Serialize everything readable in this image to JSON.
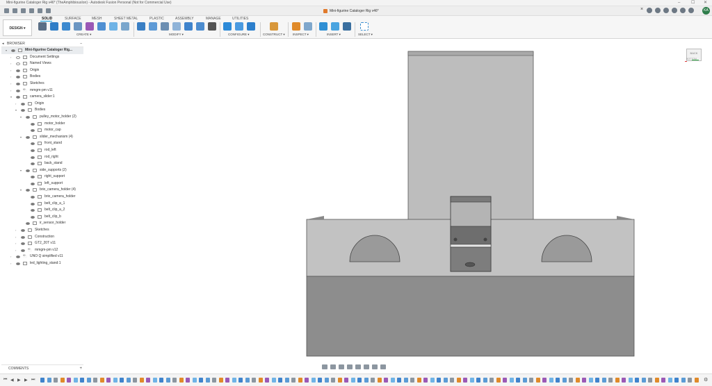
{
  "window": {
    "title": "Mini-figurine Cataloger Rig v46* (TheAmphibiousIon) - Autodesk Fusion Personal (Not for Commercial Use)",
    "minimize": "–",
    "maximize": "☐",
    "close": "✕"
  },
  "document_tab": {
    "label": "Mini-figurine Cataloger Rig v46*",
    "close": "×"
  },
  "user": {
    "initials": "KA"
  },
  "workspace": {
    "label": "DESIGN ▾"
  },
  "ribbon": {
    "tabs": [
      "SOLID",
      "SURFACE",
      "MESH",
      "SHEET METAL",
      "PLASTIC",
      "ASSEMBLY",
      "MANAGE",
      "UTILITIES"
    ],
    "active_tab": "SOLID",
    "groups": [
      "CREATE ▾",
      "MODIFY ▾",
      "CONFIGURE ▾",
      "CONSTRUCT ▾",
      "INSPECT ▾",
      "INSERT ▾",
      "SELECT ▾"
    ]
  },
  "browser": {
    "header": "BROWSER",
    "rows": [
      {
        "label": "Mini-figurine Cataloger Rig...",
        "depth": 0,
        "arrow": "▾",
        "icon": "component",
        "eye": true,
        "root": true
      },
      {
        "label": "Document Settings",
        "depth": 1,
        "arrow": "›",
        "icon": "gear",
        "eye": false
      },
      {
        "label": "Named Views",
        "depth": 1,
        "arrow": "›",
        "icon": "folder",
        "eye": false
      },
      {
        "label": "Origin",
        "depth": 1,
        "arrow": "›",
        "icon": "folder",
        "eye": true
      },
      {
        "label": "Bodies",
        "depth": 1,
        "arrow": "›",
        "icon": "folder",
        "eye": true
      },
      {
        "label": "Sketches",
        "depth": 1,
        "arrow": "›",
        "icon": "folder",
        "eye": true
      },
      {
        "label": "mmgm-pm v11",
        "depth": 1,
        "arrow": "›",
        "icon": "link",
        "eye": true
      },
      {
        "label": "camera_slider:1",
        "depth": 1,
        "arrow": "▾",
        "icon": "component",
        "eye": true
      },
      {
        "label": "Origin",
        "depth": 2,
        "arrow": "›",
        "icon": "folder",
        "eye": true
      },
      {
        "label": "Bodies",
        "depth": 2,
        "arrow": "▾",
        "icon": "folder",
        "eye": true
      },
      {
        "label": "pulley_motor_holder (2)",
        "depth": 3,
        "arrow": "▾",
        "icon": "folder",
        "eye": true
      },
      {
        "label": "motor_holder",
        "depth": 4,
        "arrow": "",
        "icon": "body",
        "eye": true
      },
      {
        "label": "motor_cap",
        "depth": 4,
        "arrow": "",
        "icon": "body",
        "eye": true
      },
      {
        "label": "slider_mechanism (4)",
        "depth": 3,
        "arrow": "▾",
        "icon": "folder",
        "eye": true
      },
      {
        "label": "front_stand",
        "depth": 4,
        "arrow": "",
        "icon": "body",
        "eye": true
      },
      {
        "label": "rod_left",
        "depth": 4,
        "arrow": "",
        "icon": "body",
        "eye": true
      },
      {
        "label": "rod_right",
        "depth": 4,
        "arrow": "",
        "icon": "body",
        "eye": true
      },
      {
        "label": "back_stand",
        "depth": 4,
        "arrow": "",
        "icon": "body",
        "eye": true
      },
      {
        "label": "side_supports (2)",
        "depth": 3,
        "arrow": "▾",
        "icon": "folder",
        "eye": true
      },
      {
        "label": "right_support",
        "depth": 4,
        "arrow": "",
        "icon": "body",
        "eye": true
      },
      {
        "label": "left_support",
        "depth": 4,
        "arrow": "",
        "icon": "body",
        "eye": true
      },
      {
        "label": "brio_camera_holder (4)",
        "depth": 3,
        "arrow": "▾",
        "icon": "folder",
        "eye": true
      },
      {
        "label": "brio_camera_holder",
        "depth": 4,
        "arrow": "",
        "icon": "body",
        "eye": true
      },
      {
        "label": "belt_clip_a_1",
        "depth": 4,
        "arrow": "",
        "icon": "body",
        "eye": true
      },
      {
        "label": "belt_clip_a_2",
        "depth": 4,
        "arrow": "",
        "icon": "body",
        "eye": true
      },
      {
        "label": "belt_clip_b",
        "depth": 4,
        "arrow": "",
        "icon": "body",
        "eye": true
      },
      {
        "label": "ir_sensor_holder",
        "depth": 3,
        "arrow": "",
        "icon": "body",
        "eye": true
      },
      {
        "label": "Sketches",
        "depth": 2,
        "arrow": "›",
        "icon": "folder",
        "eye": true
      },
      {
        "label": "Construction",
        "depth": 2,
        "arrow": "›",
        "icon": "folder",
        "eye": true
      },
      {
        "label": "GT2_20T v11",
        "depth": 2,
        "arrow": "›",
        "icon": "component",
        "eye": true
      },
      {
        "label": "mmgm-pm v12",
        "depth": 2,
        "arrow": "›",
        "icon": "link",
        "eye": true
      },
      {
        "label": "UNO Q simplified v11",
        "depth": 1,
        "arrow": "›",
        "icon": "link",
        "eye": true
      },
      {
        "label": "led_lighting_stand:1",
        "depth": 1,
        "arrow": "›",
        "icon": "component",
        "eye": true
      }
    ]
  },
  "viewcube": {
    "face": "BACK",
    "bottom": "BOTTOM"
  },
  "comments": {
    "label": "COMMENTS",
    "add": "+"
  },
  "timeline": {
    "controls": [
      "⏮",
      "◀",
      "▶",
      "▶",
      "⏭"
    ],
    "settings_icon": "⚙"
  },
  "colors": {
    "accent": "#0696d7",
    "model_top": "#b9b9b9",
    "model_bottom": "#8e8e8e",
    "background": "#ffffff"
  }
}
